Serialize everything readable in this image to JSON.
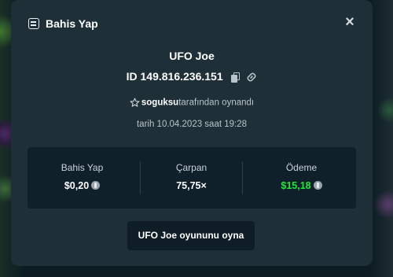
{
  "header": {
    "title": "Bahis Yap",
    "icon": "receipt-icon",
    "close_icon": "close-icon",
    "close_label": "×"
  },
  "game": {
    "title": "UFO Joe"
  },
  "bet_id": {
    "label": "ID 149.816.236.151",
    "copy_icon": "copy-icon",
    "link_icon": "link-icon"
  },
  "player": {
    "name": "soguksu",
    "suffix": "tarafından oynandı",
    "icon": "star-icon"
  },
  "date": {
    "text": "tarih 10.04.2023 saat 19:28"
  },
  "stats": {
    "bet": {
      "label": "Bahis Yap",
      "value": "$0,20",
      "currency_icon": "coin-icon"
    },
    "multiplier": {
      "label": "Çarpan",
      "value": "75,75×"
    },
    "payout": {
      "label": "Ödeme",
      "value": "$15,18",
      "currency_icon": "coin-icon",
      "color": "#1ee83a"
    }
  },
  "play_button": {
    "label": "UFO Joe oyununu oyna"
  }
}
